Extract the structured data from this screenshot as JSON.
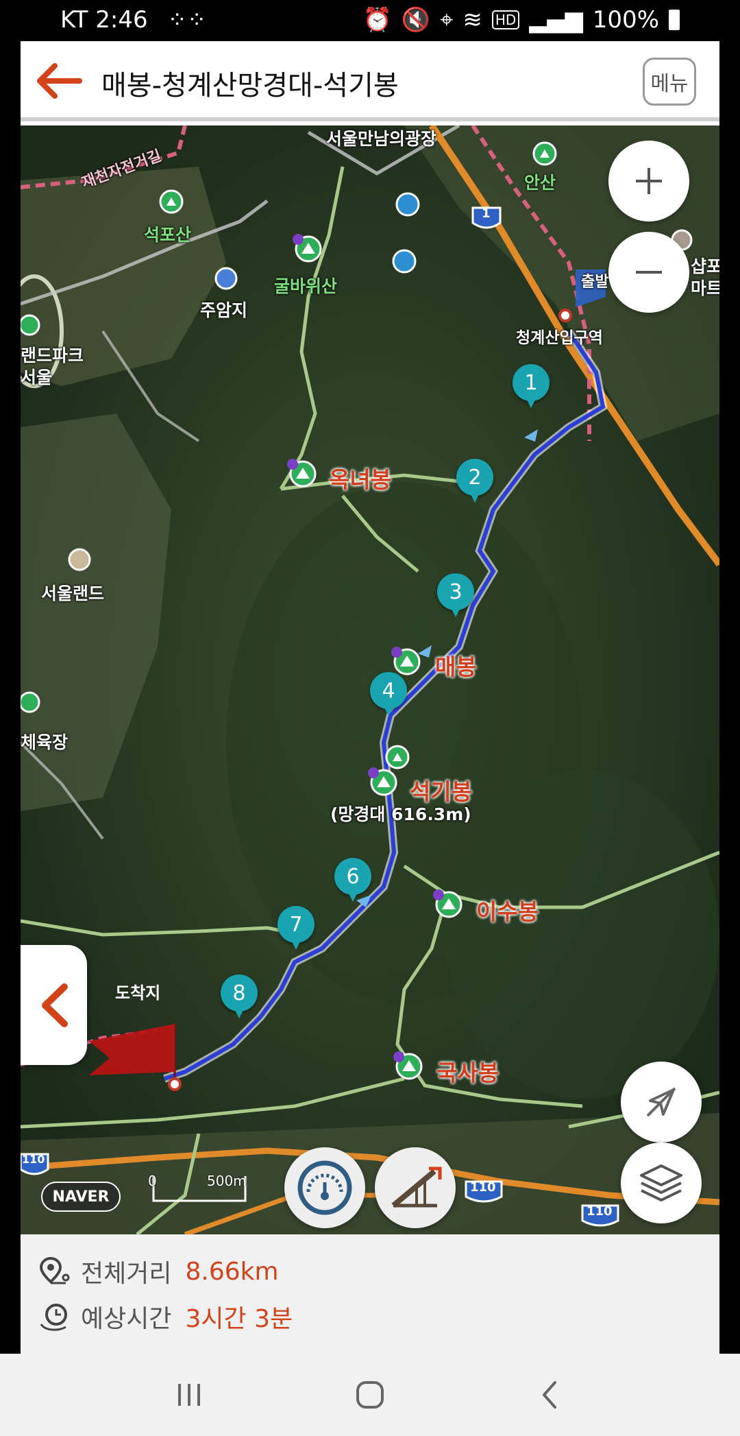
{
  "status_bar": {
    "carrier_time": "KT 2:46",
    "battery": "100%"
  },
  "header": {
    "title": "매봉-청계산망경대-석기봉",
    "menu_label": "메뉴"
  },
  "map": {
    "places": {
      "seoul_plaza": "서울만남의광장",
      "ansan": "안산",
      "bike_road": "재천자전거길",
      "seokposan": "석포산",
      "gulbawisan": "굴바위산",
      "juamji": "주암지",
      "park_left": "랜드파크\n서울",
      "cheonggye_station": "청계산입구역",
      "seoul_land": "서울랜드",
      "okneobong": "옥녀봉",
      "maebong": "매봉",
      "seokgibong": "석기봉",
      "manggyeongdae": "(망경대 616.3m)",
      "isubong": "이수봉",
      "guksabong": "국사봉",
      "stadium": "체육장",
      "right_edge": "샵포\n마트",
      "start_flag": "출발",
      "end_flag": "도착지"
    },
    "waypoints": [
      "1",
      "2",
      "3",
      "4",
      "6",
      "7",
      "8"
    ],
    "road_badges": {
      "r1": "1",
      "r110a": "110",
      "r110b": "110",
      "r110c": "110"
    },
    "scale": {
      "zero": "0",
      "distance": "500m"
    },
    "logo": "NAVER",
    "route_color": "#2b3fd6"
  },
  "info": {
    "distance_label": "전체거리",
    "distance_value": "8.66km",
    "time_label": "예상시간",
    "time_value": "3시간 3분"
  }
}
